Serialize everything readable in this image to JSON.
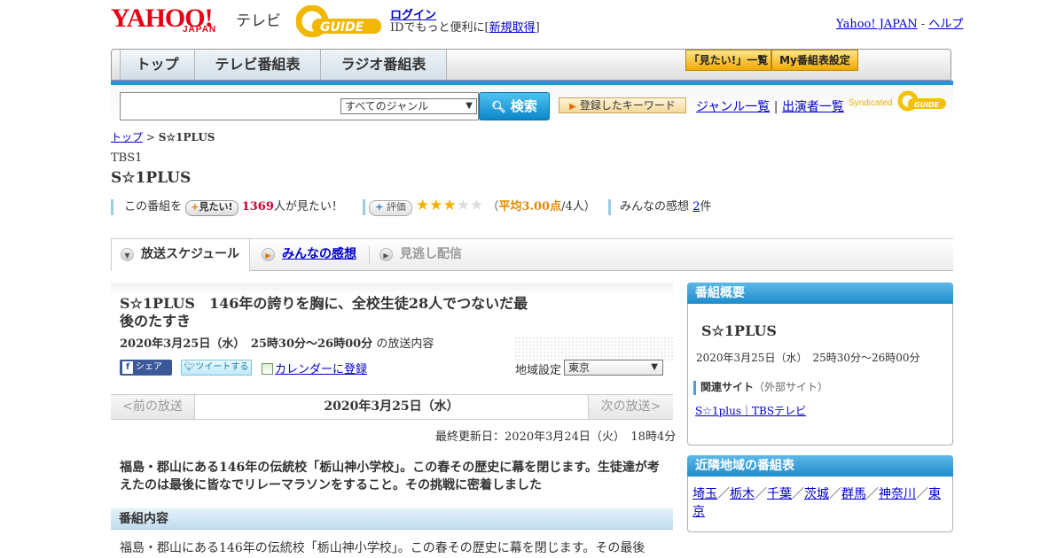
{
  "header": {
    "yahoo_logo": "YAHOO!",
    "japan_logo": "JAPAN",
    "tv_label": "テレビ",
    "gguide_logo": "G-GUIDE",
    "login": "ログイン",
    "id_prefix": "IDでもっと便利に[",
    "signup": "新規取得",
    "id_suffix": "]",
    "yahoo_japan_link": "Yahoo! JAPAN",
    "dash": "-",
    "help_link": "ヘルプ"
  },
  "nav": {
    "tabs": [
      "トップ",
      "テレビ番組表",
      "ラジオ番組表"
    ],
    "mitai_list": "「見たい!」一覧",
    "my_schedule": "My番組表設定"
  },
  "search": {
    "genre_selected": "すべてのジャンル",
    "search_button": "検索",
    "keyword_button": "登録したキーワード",
    "genre_list": "ジャンル一覧",
    "divider": "|",
    "performer_list": "出演者一覧",
    "syndicated": "Syndicated"
  },
  "breadcrumb": {
    "top": "トップ",
    "sep": ">",
    "current": "S☆1PLUS"
  },
  "program": {
    "channel": "TBS1",
    "title": "S☆1PLUS",
    "stat_prefix": "この番組を",
    "mitai_button": "見たい!",
    "mitai_count": "1369",
    "mitai_suffix": "人が見たい！",
    "hyoka_button": "評価",
    "rating_text_open": "（",
    "rating_avg": "平均3.00点",
    "rating_suffix": "/4人）",
    "rating_value": 3,
    "rating_max": 5,
    "kansou_label": "みんなの感想",
    "kansou_count": "2",
    "kansou_suffix": "件"
  },
  "subtabs": [
    "放送スケジュール",
    "みんなの感想",
    "見逃し配信"
  ],
  "episode": {
    "title": "S☆1PLUS　146年の誇りを胸に、全校生徒28人でつないだ最後のたすき",
    "date": "2020年3月25日（水）　25時30分～26時00分",
    "date_suffix": "の放送内容",
    "share": "シェア",
    "tweet": "ツイートする",
    "calendar": "カレンダーに登録",
    "region_label": "地域設定",
    "region_value": "東京",
    "prev": "<前の放送",
    "current_date": "2020年3月25日（水）",
    "next": "次の放送>",
    "updated": "最終更新日：2020年3月24日（火）　18時4分",
    "summary": "福島・郡山にある146年の伝統校「栃山神小学校」。この春その歴史に幕を閉じます。生徒達が考えたのは最後に皆なでリレーマラソンをすること。その挑戦に密着しました",
    "section_heading": "番組内容",
    "content": "福島・郡山にある146年の伝統校「栃山神小学校」。この春その歴史に幕を閉じます。その最後"
  },
  "sidebar": {
    "overview_heading": "番組概要",
    "title": "S☆1PLUS",
    "date": "2020年3月25日（水）　25時30分～26時00分",
    "related_label": "関連サイト",
    "related_sub": "（外部サイト）",
    "related_link": "S☆1plus｜TBSテレビ",
    "nearby_heading": "近隣地域の番組表",
    "prefectures": [
      "埼玉",
      "栃木",
      "千葉",
      "茨城",
      "群馬",
      "神奈川",
      "東京"
    ],
    "pref_sep": "／"
  },
  "colors": {
    "accent_blue": "#1d9ad6",
    "rating_star": "#f2b100",
    "count_red": "#cc0033"
  },
  "icons": [
    "search-icon",
    "plus-icon",
    "star-icon",
    "calendar-icon",
    "facebook-icon",
    "twitter-icon",
    "chevron-down-icon"
  ]
}
